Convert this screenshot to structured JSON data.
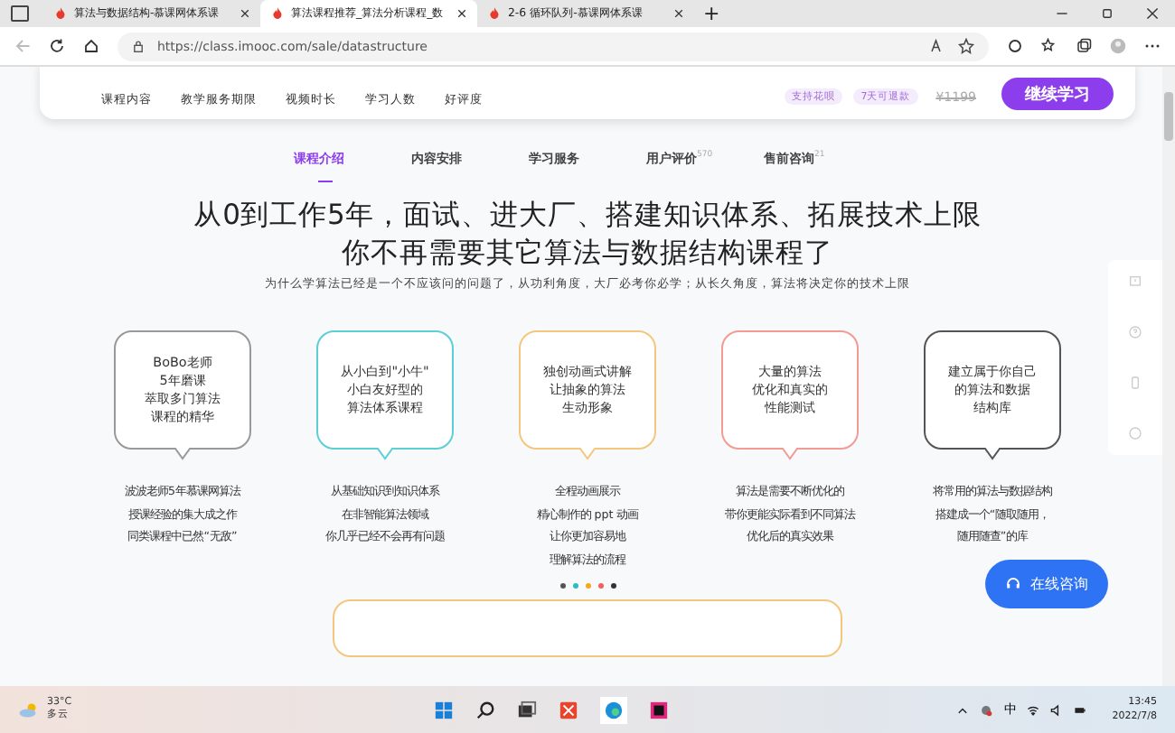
{
  "browser": {
    "tabs": [
      {
        "title": "算法与数据结构-慕课网体系课",
        "selected": false
      },
      {
        "title": "算法课程推荐_算法分析课程_数",
        "selected": true
      },
      {
        "title": "2-6 循环队列-慕课网体系课",
        "selected": false
      }
    ],
    "new_tab": "+",
    "url": "https://class.imooc.com/sale/datastructure"
  },
  "course_bar": {
    "stats": [
      {
        "label": "课程内容"
      },
      {
        "label": "教学服务期限"
      },
      {
        "label": "视频时长"
      },
      {
        "label": "学习人数"
      },
      {
        "label": "好评度"
      }
    ],
    "badges": [
      "支持花呗",
      "7天可退款"
    ],
    "old_price": "¥1199",
    "button": "继续学习"
  },
  "nav_tabs": [
    {
      "label": "课程介绍",
      "selected": true
    },
    {
      "label": "内容安排",
      "selected": false
    },
    {
      "label": "学习服务",
      "selected": false
    },
    {
      "label": "用户评价",
      "selected": false,
      "count": "570"
    },
    {
      "label": "售前咨询",
      "selected": false,
      "count": "21"
    }
  ],
  "headline": [
    "从0到工作5年，面试、进大厂、搭建知识体系、拓展技术上限",
    "你不再需要其它算法与数据结构课程了"
  ],
  "subtitle": "为什么学算法已经是一个不应该问的问题了，从功利角度，大厂必考你必学；从长久角度，算法将决定你的技术上限",
  "features": [
    {
      "bubble": [
        "BoBo老师",
        "5年磨课",
        "萃取多门算法",
        "课程的精华"
      ],
      "color": "#999999",
      "desc": [
        "波波老师5年慕课网算法",
        "授课经验的集大成之作",
        "同类课程中已然“无敌”"
      ]
    },
    {
      "bubble": [
        "从小白到\"小牛\"",
        "小白友好型的",
        "算法体系课程"
      ],
      "color": "#5ccfd6",
      "desc": [
        "从基础知识到知识体系",
        "在非智能算法领域",
        "你几乎已经不会再有问题"
      ]
    },
    {
      "bubble": [
        "独创动画式讲解",
        "让抽象的算法",
        "生动形象"
      ],
      "color": "#f5c77e",
      "desc": [
        "全程动画展示",
        "精心制作的 ppt 动画",
        "让你更加容易地",
        "理解算法的流程"
      ]
    },
    {
      "bubble": [
        "大量的算法",
        "优化和真实的",
        "性能测试"
      ],
      "color": "#f29b93",
      "desc": [
        "算法是需要不断优化的",
        "带你更能实际看到不同算法",
        "优化后的真实效果"
      ]
    },
    {
      "bubble": [
        "建立属于你自己",
        "的算法和数据",
        "结构库"
      ],
      "color": "#555555",
      "desc": [
        "将常用的算法与数据结构",
        "搭建成一个“随取随用，",
        "随用随查”的库"
      ]
    }
  ],
  "dots": [
    {
      "color": "#555555",
      "selected": false
    },
    {
      "color": "#2bbbc4",
      "selected": false
    },
    {
      "color": "#f5a623",
      "selected": false
    },
    {
      "color": "#f0625a",
      "selected": false
    },
    {
      "color": "#333333",
      "selected": false
    }
  ],
  "chat_button": "在线咨询",
  "taskbar": {
    "temperature": "33°C",
    "weather": "多云",
    "ime": "中",
    "time": "13:45",
    "date": "2022/7/8"
  }
}
